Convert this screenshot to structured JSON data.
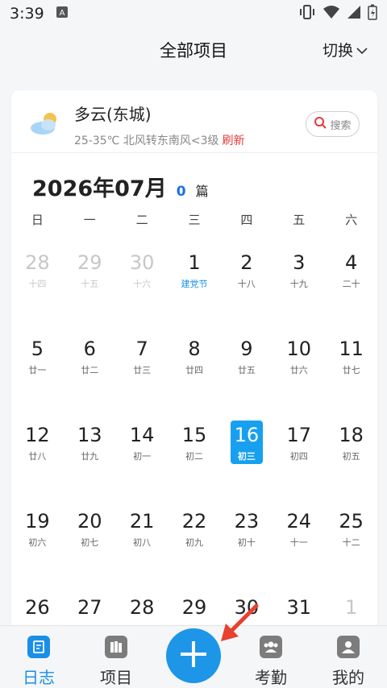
{
  "status_bar": {
    "time": "3:39"
  },
  "header": {
    "title": "全部项目",
    "switch_label": "切换"
  },
  "weather": {
    "condition": "多云(东城)",
    "detail": "25-35℃ 北风转东南风<3级",
    "refresh_label": "刷新",
    "search_label": "搜索",
    "icon": "partly-cloudy-icon"
  },
  "calendar": {
    "month_label": "2026年07月",
    "entry_count": "0",
    "entry_unit": "篇",
    "weekdays": [
      "日",
      "一",
      "二",
      "三",
      "四",
      "五",
      "六"
    ],
    "rows": [
      [
        {
          "d": "28",
          "l": "十四",
          "m": true
        },
        {
          "d": "29",
          "l": "十五",
          "m": true
        },
        {
          "d": "30",
          "l": "十六",
          "m": true
        },
        {
          "d": "1",
          "l": "建党节",
          "f": true
        },
        {
          "d": "2",
          "l": "十八"
        },
        {
          "d": "3",
          "l": "十九"
        },
        {
          "d": "4",
          "l": "二十"
        }
      ],
      [
        {
          "d": "5",
          "l": "廿一"
        },
        {
          "d": "6",
          "l": "廿二"
        },
        {
          "d": "7",
          "l": "廿三"
        },
        {
          "d": "8",
          "l": "廿四"
        },
        {
          "d": "9",
          "l": "廿五"
        },
        {
          "d": "10",
          "l": "廿六"
        },
        {
          "d": "11",
          "l": "廿七"
        }
      ],
      [
        {
          "d": "12",
          "l": "廿八"
        },
        {
          "d": "13",
          "l": "廿九"
        },
        {
          "d": "14",
          "l": "初一"
        },
        {
          "d": "15",
          "l": "初二"
        },
        {
          "d": "16",
          "l": "初三",
          "t": true
        },
        {
          "d": "17",
          "l": "初四"
        },
        {
          "d": "18",
          "l": "初五"
        }
      ],
      [
        {
          "d": "19",
          "l": "初六"
        },
        {
          "d": "20",
          "l": "初七"
        },
        {
          "d": "21",
          "l": "初八"
        },
        {
          "d": "22",
          "l": "初九"
        },
        {
          "d": "23",
          "l": "初十"
        },
        {
          "d": "24",
          "l": "十一"
        },
        {
          "d": "25",
          "l": "十二"
        }
      ],
      [
        {
          "d": "26",
          "l": ""
        },
        {
          "d": "27",
          "l": ""
        },
        {
          "d": "28",
          "l": ""
        },
        {
          "d": "29",
          "l": ""
        },
        {
          "d": "30",
          "l": ""
        },
        {
          "d": "31",
          "l": ""
        },
        {
          "d": "1",
          "l": "",
          "m": true
        }
      ]
    ]
  },
  "tabs": [
    {
      "label": "日志",
      "icon": "journal-icon",
      "active": true
    },
    {
      "label": "项目",
      "icon": "books-icon"
    },
    {
      "label": "",
      "icon": "add-icon"
    },
    {
      "label": "考勤",
      "icon": "group-icon"
    },
    {
      "label": "我的",
      "icon": "profile-icon"
    }
  ],
  "colors": {
    "accent": "#1b8fe6",
    "refresh": "#e23a3a",
    "today": "#18a0f0",
    "arrow": "#e8412f"
  }
}
